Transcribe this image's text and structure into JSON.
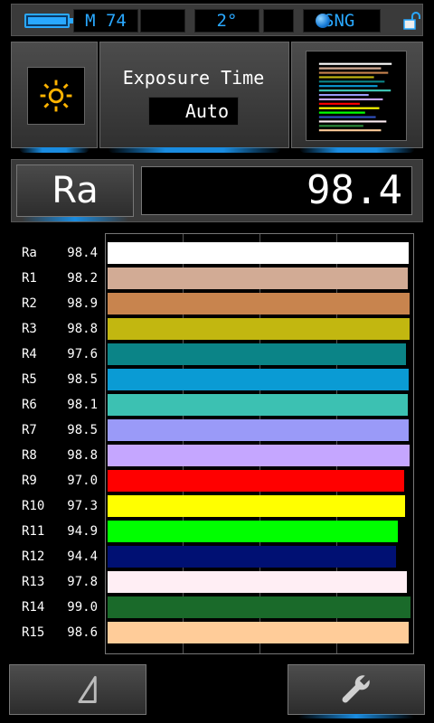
{
  "status_bar": {
    "mode": "M 74",
    "angle": "2°",
    "measure_type": "SNG"
  },
  "exposure": {
    "label": "Exposure Time",
    "value": "Auto"
  },
  "ra": {
    "label": "Ra",
    "value": "98.4"
  },
  "chart_data": {
    "type": "bar",
    "orientation": "horizontal",
    "xlim": [
      0,
      100
    ],
    "grid": true,
    "categories": [
      "Ra",
      "R1",
      "R2",
      "R3",
      "R4",
      "R5",
      "R6",
      "R7",
      "R8",
      "R9",
      "R10",
      "R11",
      "R12",
      "R13",
      "R14",
      "R15"
    ],
    "value_labels": [
      "98.4",
      "98.2",
      "98.9",
      "98.8",
      "97.6",
      "98.5",
      "98.1",
      "98.5",
      "98.8",
      "97.0",
      "97.3",
      "94.9",
      "94.4",
      "97.8",
      "99.0",
      "98.6"
    ],
    "values": [
      98.4,
      98.2,
      98.9,
      98.8,
      97.6,
      98.5,
      98.1,
      98.5,
      98.8,
      97.0,
      97.3,
      94.9,
      94.4,
      97.8,
      99.0,
      98.6
    ],
    "colors": [
      "#ffffff",
      "#d2ab95",
      "#c8844e",
      "#c2b710",
      "#0b8487",
      "#0a9bd4",
      "#3cc1b2",
      "#9a9af8",
      "#c5a6ff",
      "#ff0000",
      "#ffff00",
      "#00ff00",
      "#001073",
      "#ffeef4",
      "#1a6a2a",
      "#ffcc99"
    ]
  },
  "icons": {
    "battery": "battery-icon",
    "status_dot": "status-dot-icon",
    "lock": "lock-open-icon",
    "sun": "sun-icon",
    "spectrum": "spectrum-thumbnail",
    "back": "triangle-icon",
    "settings": "wrench-icon"
  }
}
